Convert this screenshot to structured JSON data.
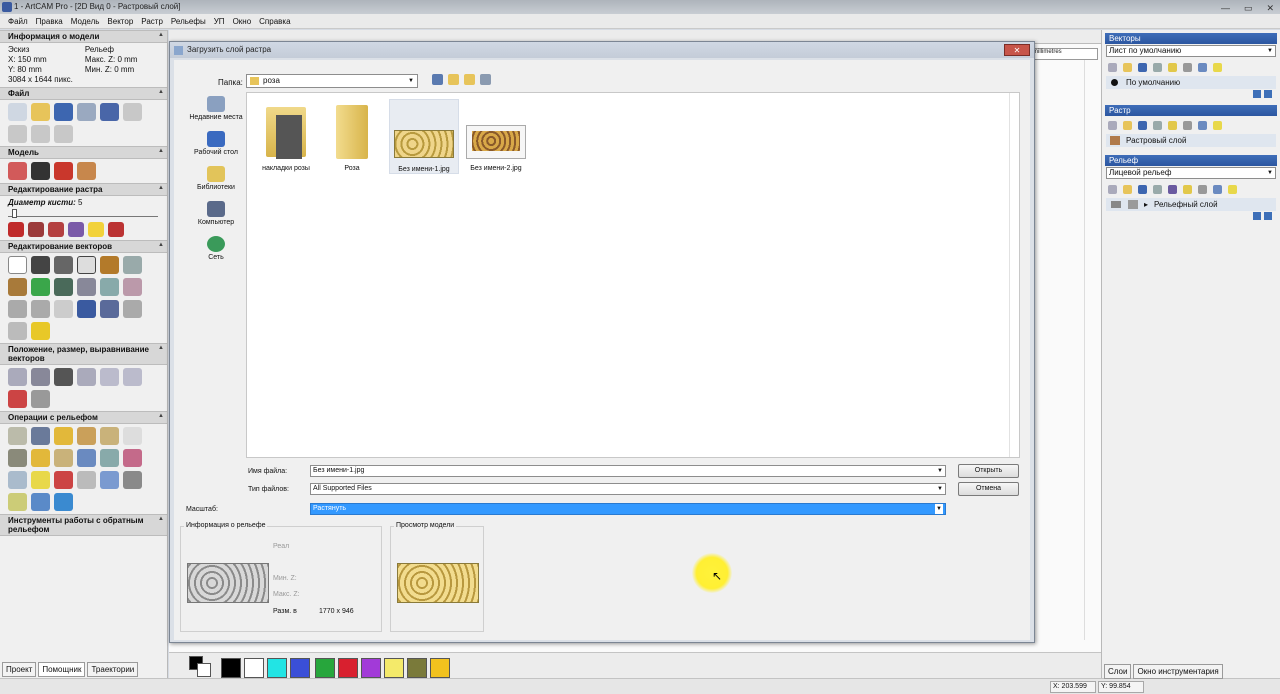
{
  "app": {
    "title": "1 - ArtCAM Pro - [2D Вид 0 - Растровый слой]"
  },
  "menu": [
    "Файл",
    "Правка",
    "Модель",
    "Вектор",
    "Растр",
    "Рельефы",
    "УП",
    "Окно",
    "Справка"
  ],
  "left": {
    "model_info": {
      "header": "Информация о модели",
      "col1": [
        "Эскиз",
        "X: 150 mm",
        "Y: 80 mm",
        "3084 x 1644 пикс."
      ],
      "col2": [
        "Рельеф",
        "Макс. Z: 0 mm",
        "Мин. Z: 0 mm"
      ]
    },
    "sections": {
      "file": "Файл",
      "model": "Модель",
      "raster_edit": "Редактирование растра",
      "vector_edit": "Редактирование векторов",
      "position": "Положение, размер, выравнивание векторов",
      "relief_ops": "Операции с рельефом",
      "reverse_tools": "Инструменты работы с обратным рельефом"
    },
    "brush": {
      "label": "Диаметр кисти:",
      "value": "5"
    },
    "tabs": [
      "Проект",
      "Помощник",
      "Траектории"
    ]
  },
  "ruler_text": "millimetres",
  "dialog": {
    "title": "Загрузить слой растра",
    "close": "✕",
    "folder_label": "Папка:",
    "folder_value": "роза",
    "places": [
      "Недавние места",
      "Рабочий стол",
      "Библиотеки",
      "Компьютер",
      "Сеть"
    ],
    "files": [
      "накладки розы",
      "Роза",
      "Без имени-1.jpg",
      "Без имени-2.jpg"
    ],
    "filename_label": "Имя файла:",
    "filename_value": "Без имени-1.jpg",
    "filetype_label": "Тип файлов:",
    "filetype_value": "All Supported Files",
    "scale_label": "Масштаб:",
    "scale_value": "Растянуть",
    "open_btn": "Открыть",
    "cancel_btn": "Отмена",
    "relief_info": {
      "title": "Информация о рельефе",
      "real": "Реал",
      "minz": "Мин. Z:",
      "maxz": "Макс. Z:",
      "size_label": "Разм. в",
      "size_value": "1770 x 946"
    },
    "preview_title": "Просмотр модели"
  },
  "right": {
    "vectors": {
      "header": "Векторы",
      "select": "Лист по умолчанию",
      "item": "По умолчанию"
    },
    "raster": {
      "header": "Растр",
      "item": "Растровый слой"
    },
    "relief": {
      "header": "Рельеф",
      "select": "Лицевой рельеф",
      "item": "Рельефный слой"
    },
    "tabs": [
      "Слои",
      "Окно инструментария"
    ]
  },
  "status": {
    "x": "X: 203.599",
    "y": "Y: 99.854"
  },
  "palette": [
    "#000000",
    "#ffffff",
    "#22e4e4",
    "#3a4fd8",
    "#27a63c",
    "#d8202f",
    "#a23ad8",
    "#f4ea6a",
    "#7a7a3a",
    "#f2c21e"
  ]
}
